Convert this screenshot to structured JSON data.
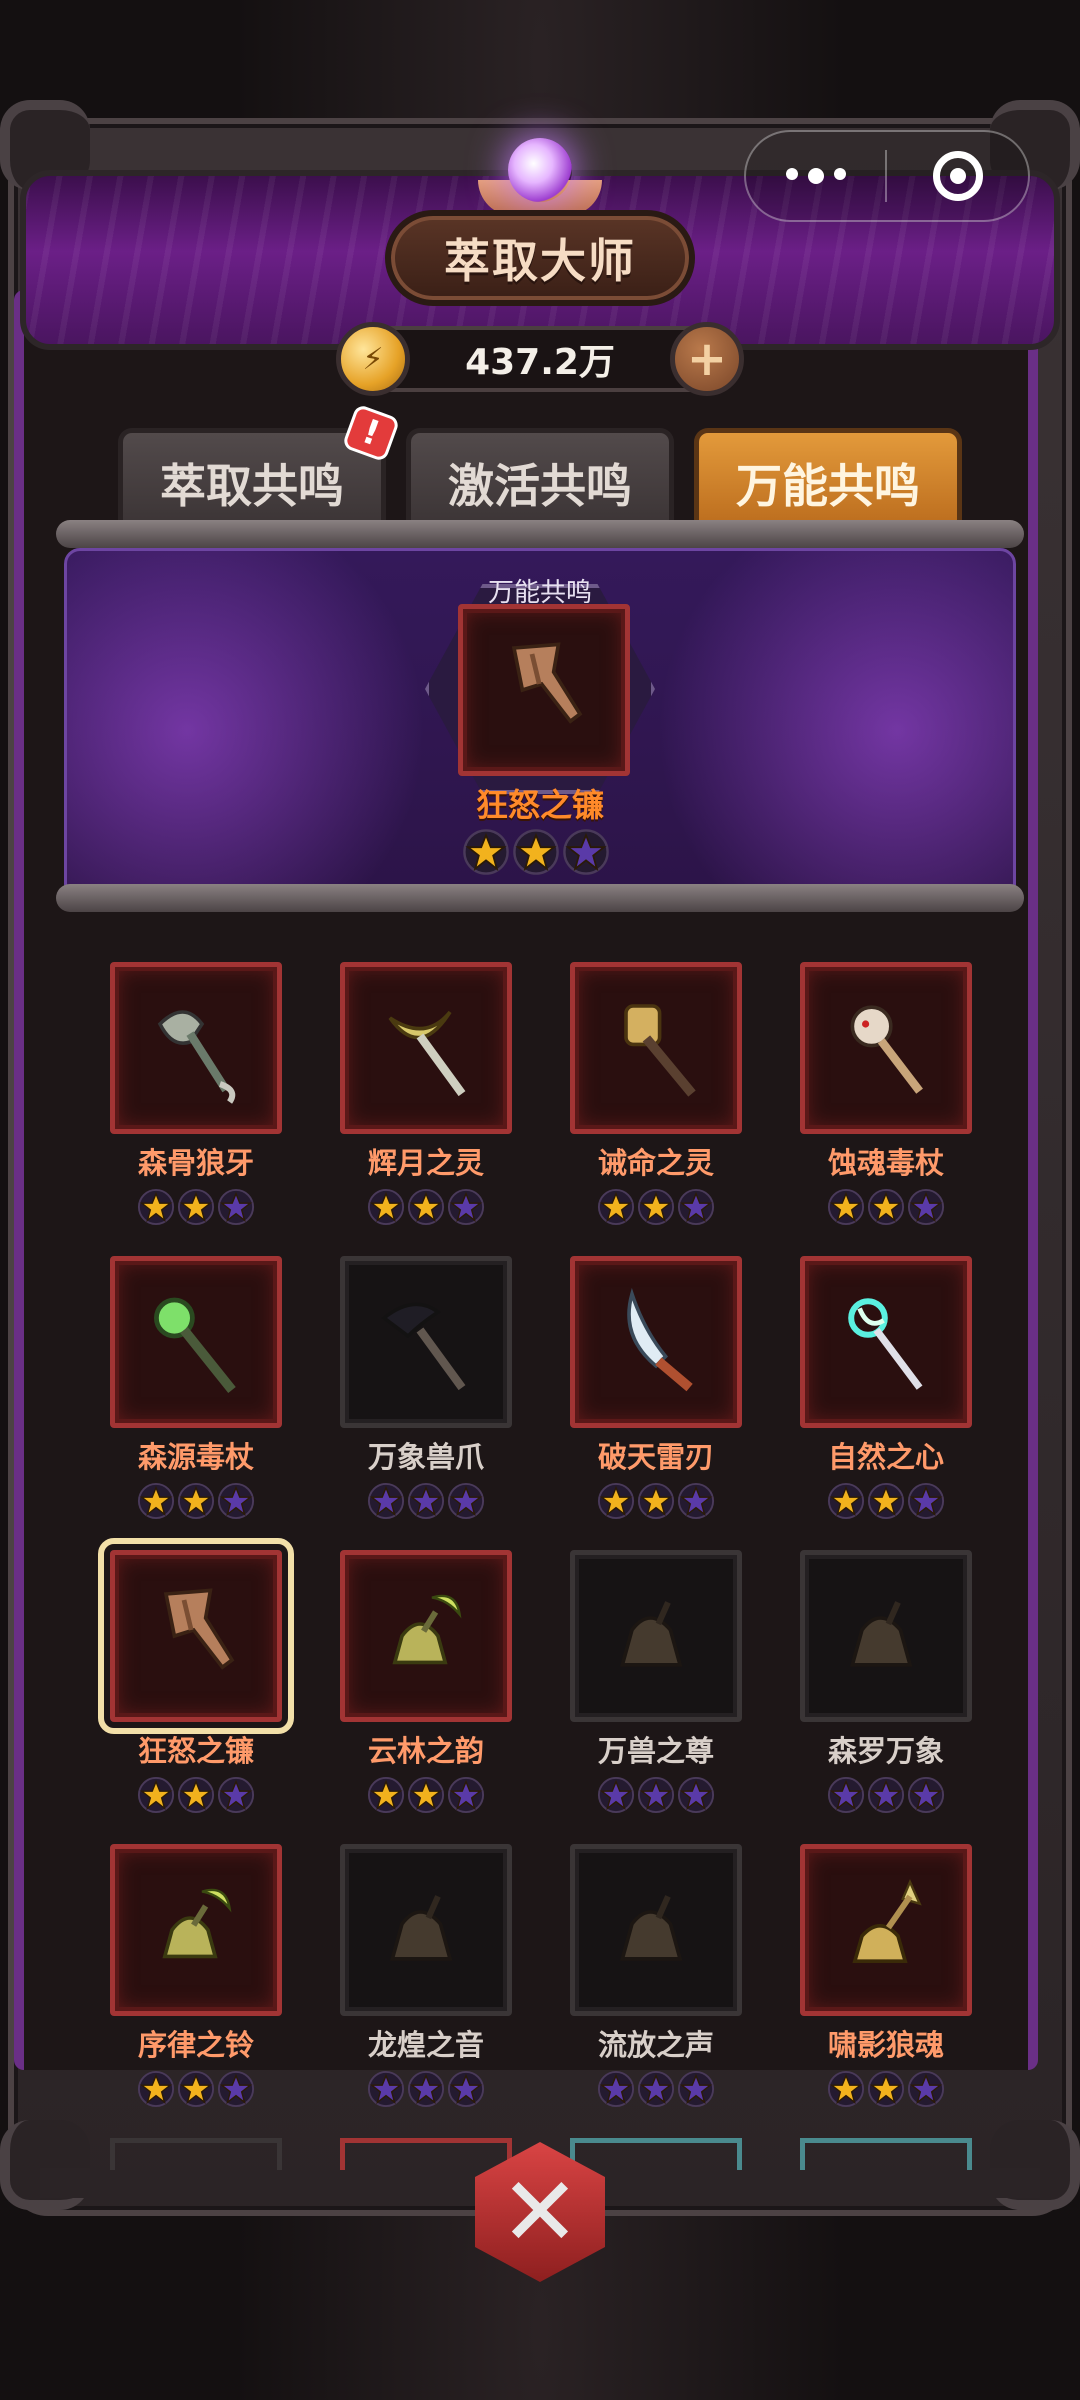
{
  "header": {
    "title": "萃取大师",
    "currency_amount": "437.2万",
    "currency_icon": "gold-coin-icon",
    "add_label": "+"
  },
  "tabs": [
    {
      "label": "萃取共鸣",
      "active": false,
      "badge": "!"
    },
    {
      "label": "激活共鸣",
      "active": false
    },
    {
      "label": "万能共鸣",
      "active": true
    }
  ],
  "featured": {
    "label": "万能共鸣",
    "name": "狂怒之镰",
    "stars": 2,
    "icon": "axe-icon"
  },
  "items": [
    {
      "name": "森骨狼牙",
      "stars": 2,
      "owned": true,
      "icon": "bone-axe-icon"
    },
    {
      "name": "辉月之灵",
      "stars": 2,
      "owned": true,
      "icon": "moon-staff-icon"
    },
    {
      "name": "诫命之灵",
      "stars": 2,
      "owned": true,
      "icon": "mace-icon"
    },
    {
      "name": "蚀魂毒杖",
      "stars": 2,
      "owned": true,
      "icon": "skull-staff-icon"
    },
    {
      "name": "森源毒杖",
      "stars": 2,
      "owned": true,
      "icon": "orb-staff-icon"
    },
    {
      "name": "万象兽爪",
      "stars": 0,
      "owned": false,
      "icon": "claw-icon"
    },
    {
      "name": "破天雷刃",
      "stars": 2,
      "owned": true,
      "icon": "blade-icon"
    },
    {
      "name": "自然之心",
      "stars": 2,
      "owned": true,
      "icon": "crystal-staff-icon"
    },
    {
      "name": "狂怒之镰",
      "stars": 2,
      "owned": true,
      "selected": true,
      "icon": "axe-icon"
    },
    {
      "name": "云林之韵",
      "stars": 2,
      "owned": true,
      "icon": "moon-bell-icon"
    },
    {
      "name": "万兽之尊",
      "stars": 0,
      "owned": false,
      "icon": "bell-icon"
    },
    {
      "name": "森罗万象",
      "stars": 0,
      "owned": false,
      "icon": "bell-icon"
    },
    {
      "name": "序律之铃",
      "stars": 2,
      "owned": true,
      "icon": "moon-bell-icon"
    },
    {
      "name": "龙煌之音",
      "stars": 0,
      "owned": false,
      "icon": "bell-icon"
    },
    {
      "name": "流放之声",
      "stars": 0,
      "owned": false,
      "icon": "bell-icon"
    },
    {
      "name": "啸影狼魂",
      "stars": 2,
      "owned": true,
      "icon": "spear-bell-icon"
    }
  ],
  "colors": {
    "star_filled": "#f2b21d",
    "star_empty": "#5a3aa8",
    "tab_active": "#d9892c",
    "accent_purple": "#6a2f86"
  }
}
